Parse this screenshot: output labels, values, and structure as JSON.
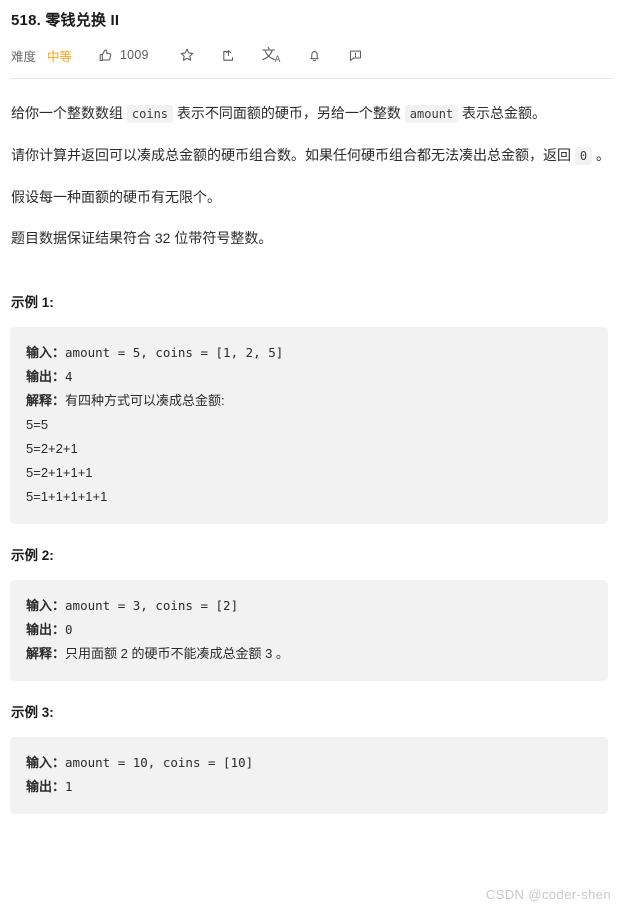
{
  "header": {
    "title": "518. 零钱兑换 II",
    "difficulty_label": "难度",
    "difficulty_value": "中等",
    "difficulty_color": "#ffa116",
    "like_count": "1009",
    "icons": [
      {
        "name": "thumbs-up-icon",
        "label": "点赞"
      },
      {
        "name": "star-icon",
        "label": "收藏"
      },
      {
        "name": "share-icon",
        "label": "分享"
      },
      {
        "name": "translate-icon",
        "label": "切换语言",
        "glyph": "文",
        "sub": "A"
      },
      {
        "name": "bell-icon",
        "label": "订阅"
      },
      {
        "name": "feedback-icon",
        "label": "反馈"
      }
    ]
  },
  "description": {
    "p1_a": "给你一个整数数组 ",
    "p1_code1": "coins",
    "p1_b": " 表示不同面额的硬币，另给一个整数 ",
    "p1_code2": "amount",
    "p1_c": " 表示总金额。",
    "p2_a": "请你计算并返回可以凑成总金额的硬币组合数。如果任何硬币组合都无法凑出总金额，返回 ",
    "p2_code1": "0",
    "p2_b": " 。",
    "p3": "假设每一种面额的硬币有无限个。",
    "p4": "题目数据保证结果符合 32 位带符号整数。"
  },
  "examples": [
    {
      "heading": "示例 1:",
      "input_label": "输入：",
      "input_value": "amount = 5, coins = [1, 2, 5]",
      "output_label": "输出：",
      "output_value": "4",
      "explain_label": "解释：",
      "explain_value": "有四种方式可以凑成总金额:",
      "equations": [
        "5=5",
        "5=2+2+1",
        "5=2+1+1+1",
        "5=1+1+1+1+1"
      ]
    },
    {
      "heading": "示例 2:",
      "input_label": "输入：",
      "input_value": "amount = 3, coins = [2]",
      "output_label": "输出：",
      "output_value": "0",
      "explain_label": "解释：",
      "explain_value": "只用面额 2 的硬币不能凑成总金额 3 。",
      "equations": []
    },
    {
      "heading": "示例 3:",
      "input_label": "输入：",
      "input_value": "amount = 10, coins = [10]",
      "output_label": "输出：",
      "output_value": "1",
      "explain_label": "",
      "explain_value": "",
      "equations": []
    }
  ],
  "watermark": "CSDN @coder-shen"
}
